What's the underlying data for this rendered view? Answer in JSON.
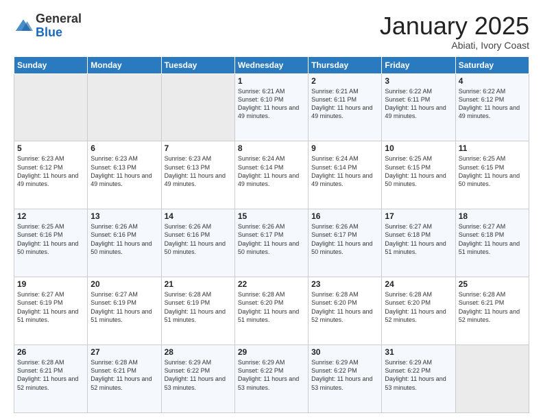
{
  "logo": {
    "general": "General",
    "blue": "Blue"
  },
  "header": {
    "month": "January 2025",
    "location": "Abiati, Ivory Coast"
  },
  "weekdays": [
    "Sunday",
    "Monday",
    "Tuesday",
    "Wednesday",
    "Thursday",
    "Friday",
    "Saturday"
  ],
  "weeks": [
    [
      {
        "day": "",
        "sunrise": "",
        "sunset": "",
        "daylight": ""
      },
      {
        "day": "",
        "sunrise": "",
        "sunset": "",
        "daylight": ""
      },
      {
        "day": "",
        "sunrise": "",
        "sunset": "",
        "daylight": ""
      },
      {
        "day": "1",
        "sunrise": "Sunrise: 6:21 AM",
        "sunset": "Sunset: 6:10 PM",
        "daylight": "Daylight: 11 hours and 49 minutes."
      },
      {
        "day": "2",
        "sunrise": "Sunrise: 6:21 AM",
        "sunset": "Sunset: 6:11 PM",
        "daylight": "Daylight: 11 hours and 49 minutes."
      },
      {
        "day": "3",
        "sunrise": "Sunrise: 6:22 AM",
        "sunset": "Sunset: 6:11 PM",
        "daylight": "Daylight: 11 hours and 49 minutes."
      },
      {
        "day": "4",
        "sunrise": "Sunrise: 6:22 AM",
        "sunset": "Sunset: 6:12 PM",
        "daylight": "Daylight: 11 hours and 49 minutes."
      }
    ],
    [
      {
        "day": "5",
        "sunrise": "Sunrise: 6:23 AM",
        "sunset": "Sunset: 6:12 PM",
        "daylight": "Daylight: 11 hours and 49 minutes."
      },
      {
        "day": "6",
        "sunrise": "Sunrise: 6:23 AM",
        "sunset": "Sunset: 6:13 PM",
        "daylight": "Daylight: 11 hours and 49 minutes."
      },
      {
        "day": "7",
        "sunrise": "Sunrise: 6:23 AM",
        "sunset": "Sunset: 6:13 PM",
        "daylight": "Daylight: 11 hours and 49 minutes."
      },
      {
        "day": "8",
        "sunrise": "Sunrise: 6:24 AM",
        "sunset": "Sunset: 6:14 PM",
        "daylight": "Daylight: 11 hours and 49 minutes."
      },
      {
        "day": "9",
        "sunrise": "Sunrise: 6:24 AM",
        "sunset": "Sunset: 6:14 PM",
        "daylight": "Daylight: 11 hours and 49 minutes."
      },
      {
        "day": "10",
        "sunrise": "Sunrise: 6:25 AM",
        "sunset": "Sunset: 6:15 PM",
        "daylight": "Daylight: 11 hours and 50 minutes."
      },
      {
        "day": "11",
        "sunrise": "Sunrise: 6:25 AM",
        "sunset": "Sunset: 6:15 PM",
        "daylight": "Daylight: 11 hours and 50 minutes."
      }
    ],
    [
      {
        "day": "12",
        "sunrise": "Sunrise: 6:25 AM",
        "sunset": "Sunset: 6:16 PM",
        "daylight": "Daylight: 11 hours and 50 minutes."
      },
      {
        "day": "13",
        "sunrise": "Sunrise: 6:26 AM",
        "sunset": "Sunset: 6:16 PM",
        "daylight": "Daylight: 11 hours and 50 minutes."
      },
      {
        "day": "14",
        "sunrise": "Sunrise: 6:26 AM",
        "sunset": "Sunset: 6:16 PM",
        "daylight": "Daylight: 11 hours and 50 minutes."
      },
      {
        "day": "15",
        "sunrise": "Sunrise: 6:26 AM",
        "sunset": "Sunset: 6:17 PM",
        "daylight": "Daylight: 11 hours and 50 minutes."
      },
      {
        "day": "16",
        "sunrise": "Sunrise: 6:26 AM",
        "sunset": "Sunset: 6:17 PM",
        "daylight": "Daylight: 11 hours and 50 minutes."
      },
      {
        "day": "17",
        "sunrise": "Sunrise: 6:27 AM",
        "sunset": "Sunset: 6:18 PM",
        "daylight": "Daylight: 11 hours and 51 minutes."
      },
      {
        "day": "18",
        "sunrise": "Sunrise: 6:27 AM",
        "sunset": "Sunset: 6:18 PM",
        "daylight": "Daylight: 11 hours and 51 minutes."
      }
    ],
    [
      {
        "day": "19",
        "sunrise": "Sunrise: 6:27 AM",
        "sunset": "Sunset: 6:19 PM",
        "daylight": "Daylight: 11 hours and 51 minutes."
      },
      {
        "day": "20",
        "sunrise": "Sunrise: 6:27 AM",
        "sunset": "Sunset: 6:19 PM",
        "daylight": "Daylight: 11 hours and 51 minutes."
      },
      {
        "day": "21",
        "sunrise": "Sunrise: 6:28 AM",
        "sunset": "Sunset: 6:19 PM",
        "daylight": "Daylight: 11 hours and 51 minutes."
      },
      {
        "day": "22",
        "sunrise": "Sunrise: 6:28 AM",
        "sunset": "Sunset: 6:20 PM",
        "daylight": "Daylight: 11 hours and 51 minutes."
      },
      {
        "day": "23",
        "sunrise": "Sunrise: 6:28 AM",
        "sunset": "Sunset: 6:20 PM",
        "daylight": "Daylight: 11 hours and 52 minutes."
      },
      {
        "day": "24",
        "sunrise": "Sunrise: 6:28 AM",
        "sunset": "Sunset: 6:20 PM",
        "daylight": "Daylight: 11 hours and 52 minutes."
      },
      {
        "day": "25",
        "sunrise": "Sunrise: 6:28 AM",
        "sunset": "Sunset: 6:21 PM",
        "daylight": "Daylight: 11 hours and 52 minutes."
      }
    ],
    [
      {
        "day": "26",
        "sunrise": "Sunrise: 6:28 AM",
        "sunset": "Sunset: 6:21 PM",
        "daylight": "Daylight: 11 hours and 52 minutes."
      },
      {
        "day": "27",
        "sunrise": "Sunrise: 6:28 AM",
        "sunset": "Sunset: 6:21 PM",
        "daylight": "Daylight: 11 hours and 52 minutes."
      },
      {
        "day": "28",
        "sunrise": "Sunrise: 6:29 AM",
        "sunset": "Sunset: 6:22 PM",
        "daylight": "Daylight: 11 hours and 53 minutes."
      },
      {
        "day": "29",
        "sunrise": "Sunrise: 6:29 AM",
        "sunset": "Sunset: 6:22 PM",
        "daylight": "Daylight: 11 hours and 53 minutes."
      },
      {
        "day": "30",
        "sunrise": "Sunrise: 6:29 AM",
        "sunset": "Sunset: 6:22 PM",
        "daylight": "Daylight: 11 hours and 53 minutes."
      },
      {
        "day": "31",
        "sunrise": "Sunrise: 6:29 AM",
        "sunset": "Sunset: 6:22 PM",
        "daylight": "Daylight: 11 hours and 53 minutes."
      },
      {
        "day": "",
        "sunrise": "",
        "sunset": "",
        "daylight": ""
      }
    ]
  ]
}
